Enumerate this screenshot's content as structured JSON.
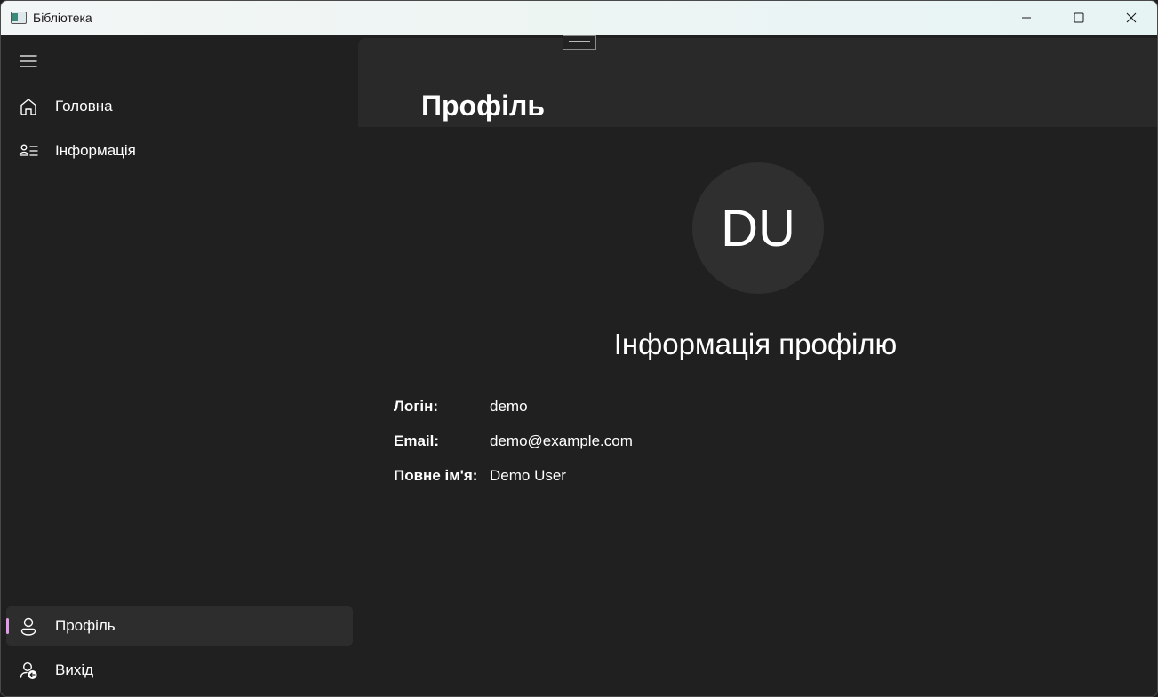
{
  "window": {
    "title": "Бібліотека"
  },
  "icons": {
    "app": "app-window-icon",
    "minimize": "minimize-icon",
    "maximize": "maximize-icon",
    "close": "close-icon",
    "menu": "hamburger-menu-icon",
    "home": "home-icon",
    "info": "contact-info-icon",
    "profile": "person-icon",
    "logout": "sign-out-icon"
  },
  "sidebar": {
    "items": [
      {
        "label": "Головна"
      },
      {
        "label": "Інформація"
      }
    ],
    "footer_items": [
      {
        "label": "Профіль",
        "selected": true
      },
      {
        "label": "Вихід"
      }
    ],
    "accent": "#e29ce8"
  },
  "page": {
    "title": "Профіль",
    "avatar_initials": "DU",
    "section_title": "Інформація профілю",
    "fields": [
      {
        "key": "Логін:",
        "value": "demo"
      },
      {
        "key": "Email:",
        "value": "demo@example.com"
      },
      {
        "key": "Повне ім'я:",
        "value": "Demo User"
      }
    ]
  }
}
